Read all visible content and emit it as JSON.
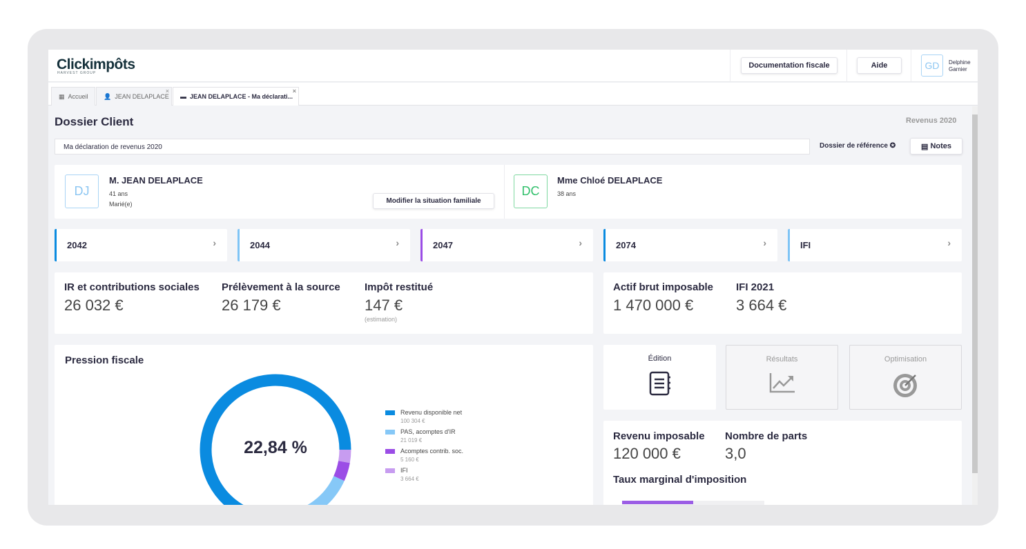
{
  "header": {
    "logo": "Clickimpôts",
    "logo_sub": "HARVEST GROUP",
    "doc_button": "Documentation fiscale",
    "help_button": "Aide",
    "user_initials": "GD",
    "user_first": "Delphine",
    "user_last": "Garnier"
  },
  "tabs": [
    {
      "label": "Accueil"
    },
    {
      "label": "JEAN DELAPLACE"
    },
    {
      "label": "JEAN DELAPLACE - Ma déclarati..."
    }
  ],
  "page": {
    "title": "Dossier Client",
    "year": "Revenus 2020",
    "declaration": "Ma déclaration de revenus 2020",
    "reference": "Dossier de référence",
    "notes": "Notes"
  },
  "persons": [
    {
      "initials": "DJ",
      "name": "M. JEAN DELAPLACE",
      "age": "41 ans",
      "status": "Marié(e)"
    },
    {
      "initials": "DC",
      "name": "Mme Chloé DELAPLACE",
      "age": "38 ans"
    }
  ],
  "modify_button": "Modifier la situation familiale",
  "forms": [
    {
      "label": "2042",
      "color": "#0a8be0"
    },
    {
      "label": "2044",
      "color": "#7fc4f5"
    },
    {
      "label": "2047",
      "color": "#9b4de6"
    },
    {
      "label": "2074",
      "color": "#0a8be0"
    },
    {
      "label": "IFI",
      "color": "#7fc4f5"
    }
  ],
  "summary": [
    {
      "label": "IR et contributions sociales",
      "value": "26 032 €"
    },
    {
      "label": "Prélèvement à la source",
      "value": "26 179 €"
    },
    {
      "label": "Impôt restitué",
      "value": "147 €",
      "note": "(estimation)"
    }
  ],
  "ifi": [
    {
      "label": "Actif brut imposable",
      "value": "1 470 000 €"
    },
    {
      "label": "IFI 2021",
      "value": "3 664 €"
    }
  ],
  "modes": [
    {
      "label": "Édition",
      "icon": "notebook-icon"
    },
    {
      "label": "Résultats",
      "icon": "chart-line-icon"
    },
    {
      "label": "Optimisation",
      "icon": "target-icon"
    }
  ],
  "taxinfo": {
    "revenu_label": "Revenu imposable",
    "revenu_value": "120 000 €",
    "parts_label": "Nombre de parts",
    "parts_value": "3,0",
    "tmi_label": "Taux marginal d'imposition"
  },
  "chart_data": {
    "type": "pie",
    "title": "Pression fiscale",
    "center_label": "22,84 %",
    "legend": "right",
    "slices": [
      {
        "name": "Revenu disponible net",
        "value": 100304,
        "display": "100 304 €",
        "color": "#0a8be0"
      },
      {
        "name": "PAS, acomptes d'IR",
        "value": 21019,
        "display": "21 019 €",
        "color": "#86c8f7"
      },
      {
        "name": "Acomptes contrib. soc.",
        "value": 5160,
        "display": "5 160 €",
        "color": "#9b4de6"
      },
      {
        "name": "IFI",
        "value": 3664,
        "display": "3 664 €",
        "color": "#c79cf0"
      }
    ]
  }
}
